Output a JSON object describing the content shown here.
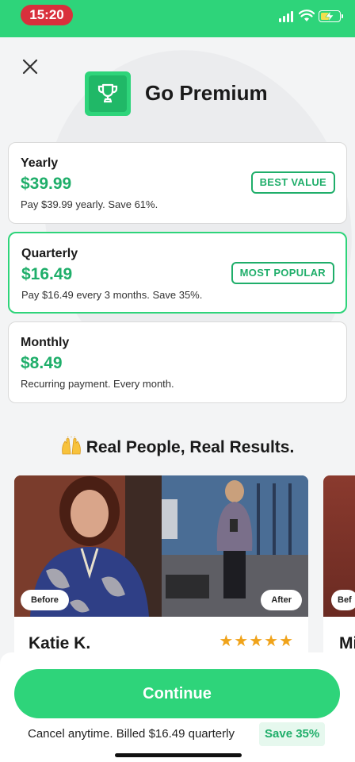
{
  "status_bar": {
    "time": "15:20",
    "icons": [
      "signal-icon",
      "wifi-icon",
      "battery-charging-icon"
    ]
  },
  "header": {
    "title": "Go Premium",
    "close_icon": "close-icon",
    "trophy_icon": "trophy-icon"
  },
  "plans": [
    {
      "name": "Yearly",
      "price": "$39.99",
      "desc": "Pay $39.99 yearly. Save 61%.",
      "badge": "BEST VALUE",
      "selected": false
    },
    {
      "name": "Quarterly",
      "price": "$16.49",
      "desc": "Pay $16.49 every 3 months. Save 35%.",
      "badge": "MOST POPULAR",
      "selected": true
    },
    {
      "name": "Monthly",
      "price": "$8.49",
      "desc": "Recurring payment. Every month.",
      "badge": "",
      "selected": false
    }
  ],
  "results": {
    "heading": "Real People, Real Results.",
    "emoji_icon": "raising-hands-icon",
    "cards": [
      {
        "name": "Katie K.",
        "before_label": "Before",
        "after_label": "After",
        "stars": "★★★★★",
        "rating": 5
      },
      {
        "name": "Mi",
        "before_label": "Bef"
      }
    ]
  },
  "footer": {
    "continue_label": "Continue",
    "note": "Cancel anytime. Billed $16.49 quarterly",
    "save_label": "Save 35%"
  },
  "colors": {
    "brand_green": "#2ed47a",
    "price_green": "#1fae6a",
    "status_red": "#d9303c",
    "star_orange": "#f0a31a"
  }
}
